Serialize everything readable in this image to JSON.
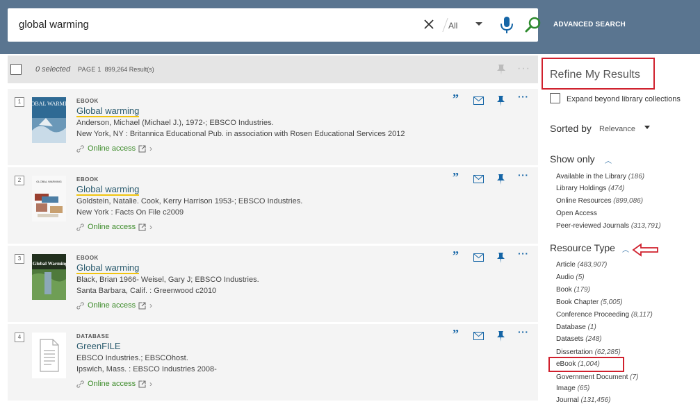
{
  "search": {
    "query": "global warming",
    "scope": "All",
    "advanced_label": "ADVANCED SEARCH"
  },
  "results_bar": {
    "selected": "0 selected",
    "page": "PAGE 1",
    "count": "899,264 Result(s)"
  },
  "records": [
    {
      "num": "1",
      "type": "EBOOK",
      "title": "Global warming",
      "authors": "Anderson, Michael (Michael J.), 1972-; EBSCO Industries.",
      "publisher": "New York, NY : Britannica Educational Pub. in association with Rosen Educational Services 2012",
      "access": "Online access",
      "thumb": "GLOBAL WARMING"
    },
    {
      "num": "2",
      "type": "EBOOK",
      "title": "Global warming",
      "authors": "Goldstein, Natalie. Cook, Kerry Harrison 1953-; EBSCO Industries.",
      "publisher": "New York : Facts On File c2009",
      "access": "Online access",
      "thumb": "GLOBAL WARMING"
    },
    {
      "num": "3",
      "type": "EBOOK",
      "title": "Global warming",
      "authors": "Black, Brian 1966- Weisel, Gary J; EBSCO Industries.",
      "publisher": "Santa Barbara, Calif. : Greenwood c2010",
      "access": "Online access",
      "thumb": "Global Warming"
    },
    {
      "num": "4",
      "type": "DATABASE",
      "title": "GreenFILE",
      "authors": "EBSCO Industries.; EBSCOhost.",
      "publisher": "Ipswich, Mass. : EBSCO Industries 2008-",
      "access": "Online access"
    }
  ],
  "sidebar": {
    "refine_title": "Refine My Results",
    "expand_label": "Expand beyond library collections",
    "sorted_label": "Sorted by",
    "sorted_value": "Relevance",
    "show_only": {
      "heading": "Show only",
      "items": [
        {
          "label": "Available in the Library",
          "count": "(186)"
        },
        {
          "label": "Library Holdings",
          "count": "(474)"
        },
        {
          "label": "Online Resources",
          "count": "(899,086)"
        },
        {
          "label": "Open Access",
          "count": ""
        },
        {
          "label": "Peer-reviewed Journals",
          "count": "(313,791)"
        }
      ]
    },
    "resource_type": {
      "heading": "Resource Type",
      "items": [
        {
          "label": "Article",
          "count": "(483,907)"
        },
        {
          "label": "Audio",
          "count": "(5)"
        },
        {
          "label": "Book",
          "count": "(179)"
        },
        {
          "label": "Book Chapter",
          "count": "(5,005)"
        },
        {
          "label": "Conference Proceeding",
          "count": "(8,117)"
        },
        {
          "label": "Database",
          "count": "(1)"
        },
        {
          "label": "Datasets",
          "count": "(248)"
        },
        {
          "label": "Dissertation",
          "count": "(62,285)"
        },
        {
          "label": "eBook",
          "count": "(1,004)"
        },
        {
          "label": "Government Document",
          "count": "(7)"
        },
        {
          "label": "Image",
          "count": "(65)"
        },
        {
          "label": "Journal",
          "count": "(131,456)"
        }
      ]
    }
  },
  "colors": {
    "header_bg": "#5a7590",
    "title_link": "#2b5b6e",
    "access_green": "#3a8a27",
    "action_blue": "#1565a6",
    "highlight_red": "#d0202d"
  }
}
